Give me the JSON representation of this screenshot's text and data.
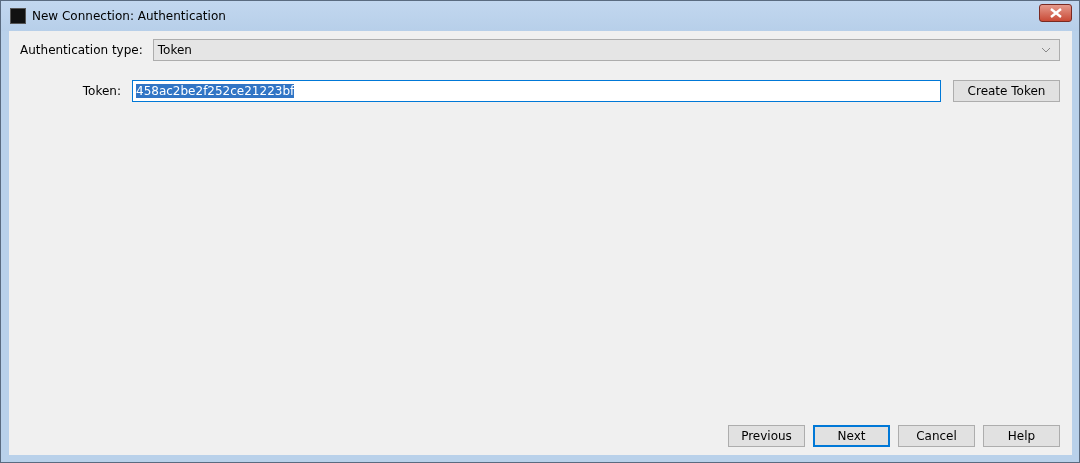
{
  "window": {
    "title": "New Connection: Authentication"
  },
  "auth_type": {
    "label": "Authentication type:",
    "value": "Token"
  },
  "token": {
    "label": "Token:",
    "value": "458ac2be2f252ce21223bf",
    "text_selected": true,
    "button": "Create Token"
  },
  "buttons": [
    {
      "label": "Previous",
      "focused": false
    },
    {
      "label": "Next",
      "focused": true
    },
    {
      "label": "Cancel",
      "focused": false
    },
    {
      "label": "Help",
      "focused": false
    }
  ]
}
